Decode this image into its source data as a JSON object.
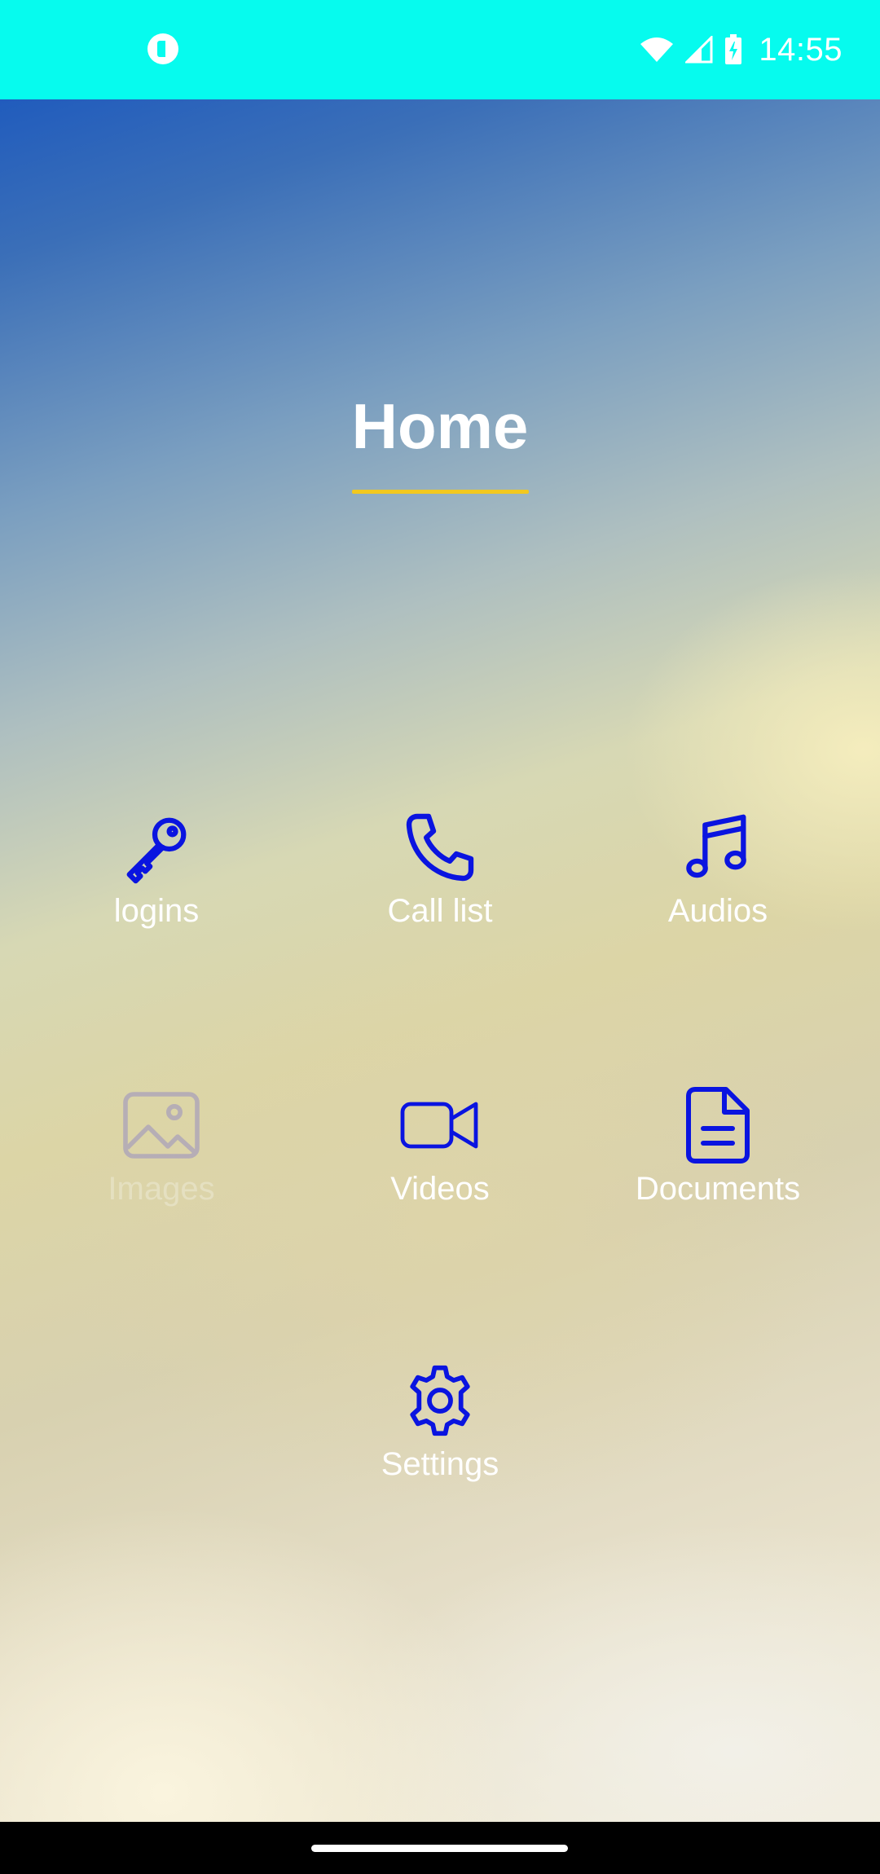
{
  "status_bar": {
    "time": "14:55",
    "background": "#06fbee",
    "icons": [
      "app-notification-icon",
      "wifi-icon",
      "signal-icon",
      "battery-charging-icon"
    ]
  },
  "page": {
    "title": "Home",
    "underline_color": "#f2c81f"
  },
  "menu": {
    "icon_color": "#0a14e0",
    "label_color": "#ffffff",
    "items": [
      {
        "label": "logins",
        "icon": "key-icon",
        "enabled": true
      },
      {
        "label": "Call list",
        "icon": "phone-icon",
        "enabled": true
      },
      {
        "label": "Audios",
        "icon": "music-note-icon",
        "enabled": true
      },
      {
        "label": "Images",
        "icon": "image-icon",
        "enabled": false
      },
      {
        "label": "Videos",
        "icon": "video-camera-icon",
        "enabled": true
      },
      {
        "label": "Documents",
        "icon": "document-icon",
        "enabled": true
      },
      {
        "label": "Settings",
        "icon": "gear-icon",
        "enabled": true
      }
    ]
  }
}
